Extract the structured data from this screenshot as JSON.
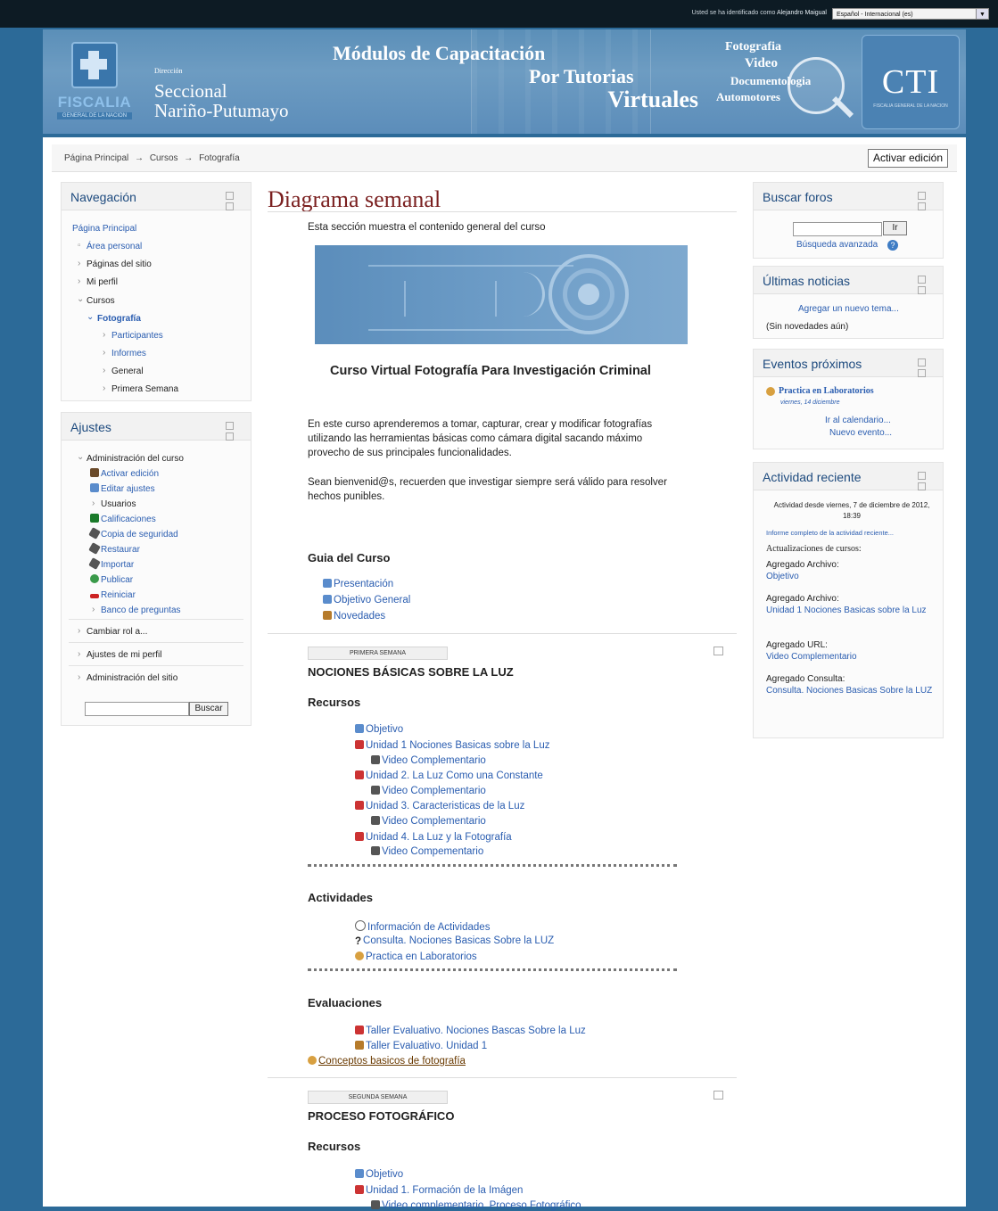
{
  "topbar": {
    "login_text": "Usted se ha identificado como",
    "user_name": "Alejandro Maigual",
    "language": "Español - Internacional (es)"
  },
  "banner": {
    "logo_text": "FISCALIA",
    "logo_sub": "GENERAL DE LA NACION",
    "dir_small": "Dirección",
    "dir_line1": "Seccional",
    "dir_line2": "Nariño-Putumayo",
    "title_l1": "Módulos de Capacitación",
    "title_l2": "Por Tutorias",
    "title_l3": "Virtuales",
    "photo_w1": "Fotografia",
    "photo_w2": "Video",
    "photo_w3": "Documentologia",
    "photo_w4": "Automotores",
    "cti": "CTI",
    "cti_sub": "FISCALIA GENERAL DE LA NACION"
  },
  "breadcrumb": {
    "home": "Página Principal",
    "courses": "Cursos",
    "current": "Fotografía",
    "sep": "→"
  },
  "edit_button": "Activar edición",
  "navigation": {
    "title": "Navegación",
    "home": "Página Principal",
    "items": [
      "Área personal",
      "Páginas del sitio",
      "Mi perfil",
      "Cursos",
      "Fotografía",
      "Participantes",
      "Informes",
      "General",
      "Primera Semana"
    ]
  },
  "settings": {
    "title": "Ajustes",
    "admin_title": "Administración del curso",
    "admin_items": [
      "Activar edición",
      "Editar ajustes",
      "Usuarios",
      "Calificaciones",
      "Copia de seguridad",
      "Restaurar",
      "Importar",
      "Publicar",
      "Reiniciar",
      "Banco de preguntas"
    ],
    "other_items": [
      "Cambiar rol a...",
      "Ajustes de mi perfil",
      "Administración del sitio"
    ],
    "search_button": "Buscar"
  },
  "main": {
    "title": "Diagrama semanal",
    "intro": "Esta sección muestra el contenido general del curso",
    "course_title": "Curso Virtual Fotografía Para Investigación Criminal",
    "desc1": "En este curso aprenderemos a tomar, capturar, crear y modificar fotografías utilizando las herramientas básicas como cámara digital sacando máximo provecho de sus principales funcionalidades.",
    "desc2": "Sean bienvenid@s, recuerden que investigar siempre será válido para resolver hechos punibles.",
    "guide_title": "Guia del Curso",
    "guide_items": [
      "Presentación",
      "Objetivo General",
      "Novedades"
    ],
    "week1": {
      "label": "PRIMERA SEMANA",
      "title": "NOCIONES BÁSICAS SOBRE LA LUZ",
      "resources_title": "Recursos",
      "resources": [
        "Objetivo",
        "Unidad 1 Nociones Basicas sobre la Luz",
        "Video Complementario",
        "Unidad 2. La Luz Como una Constante",
        "Video Complementario",
        "Unidad 3. Caracteristicas de la Luz",
        "Video Complementario",
        "Unidad 4. La Luz y la Fotografía",
        "Video Compementario"
      ],
      "activities_title": "Actividades",
      "activities": [
        "Información de Actividades",
        "Consulta. Nociones Basicas Sobre la LUZ",
        "Practica en Laboratorios"
      ],
      "eval_title": "Evaluaciones",
      "evaluations": [
        "Taller Evaluativo. Nociones Bascas Sobre la Luz",
        "Taller Evaluativo. Unidad 1"
      ],
      "extra": "Conceptos basicos de fotografía"
    },
    "week2": {
      "label": "SEGUNDA SEMANA",
      "title": "PROCESO FOTOGRÁFICO",
      "resources_title": "Recursos",
      "resources": [
        "Objetivo",
        "Unidad 1. Formación de la Imágen",
        "Video complementario. Proceso Fotográfico"
      ]
    }
  },
  "search_forums": {
    "title": "Buscar foros",
    "button": "Ir",
    "advanced": "Búsqueda avanzada"
  },
  "news": {
    "title": "Últimas noticias",
    "add": "Agregar un nuevo tema...",
    "none": "(Sin novedades aún)"
  },
  "events": {
    "title": "Eventos próximos",
    "event_name": "Practica en Laboratorios",
    "event_date": "viernes, 14 diciembre",
    "calendar": "Ir al calendario...",
    "new_event": "Nuevo evento..."
  },
  "recent": {
    "title": "Actividad reciente",
    "since": "Actividad desde viernes, 7 de diciembre de 2012, 18:39",
    "report": "Informe completo de la actividad reciente...",
    "updates_title": "Actualizaciones de cursos:",
    "updates": [
      {
        "type": "Agregado Archivo:",
        "item": "Objetivo"
      },
      {
        "type": "Agregado Archivo:",
        "item": "Unidad 1 Nociones Basicas sobre la Luz"
      },
      {
        "type": "Agregado URL:",
        "item": "Video Complementario"
      },
      {
        "type": "Agregado Consulta:",
        "item": "Consulta. Nociones Basicas Sobre la LUZ"
      }
    ]
  }
}
